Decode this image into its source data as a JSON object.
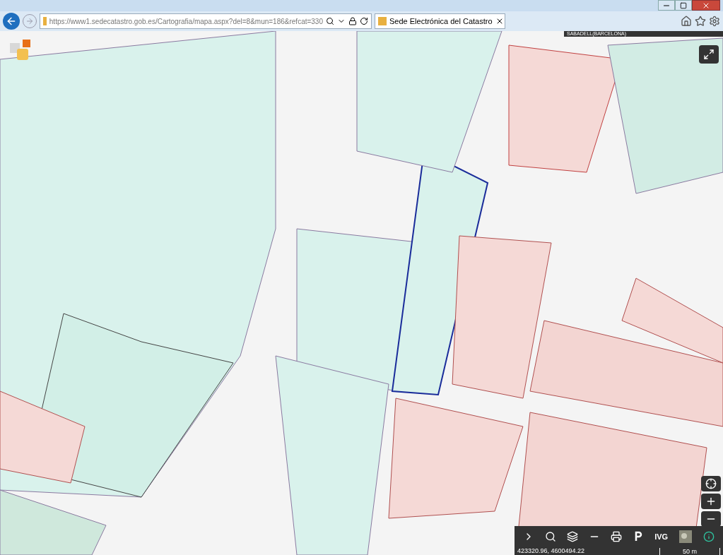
{
  "browser": {
    "url": "https://www1.sedecatastro.gob.es/Cartografia/mapa.aspx?del=8&mun=186&refcat=330",
    "tab": {
      "title": "Sede Electrónica del Catastro",
      "selected": true
    }
  },
  "map": {
    "location": "SABADELL(BARCELONA)",
    "coordinates": "423320.96, 4600494.22",
    "scale": "50 m",
    "toolbar": [
      {
        "kind": "chevron"
      },
      {
        "kind": "search"
      },
      {
        "kind": "layers"
      },
      {
        "kind": "measure"
      },
      {
        "kind": "print"
      },
      {
        "kind": "parking"
      },
      {
        "kind": "text",
        "label": "IVG"
      },
      {
        "kind": "aerial"
      },
      {
        "kind": "info"
      }
    ]
  }
}
